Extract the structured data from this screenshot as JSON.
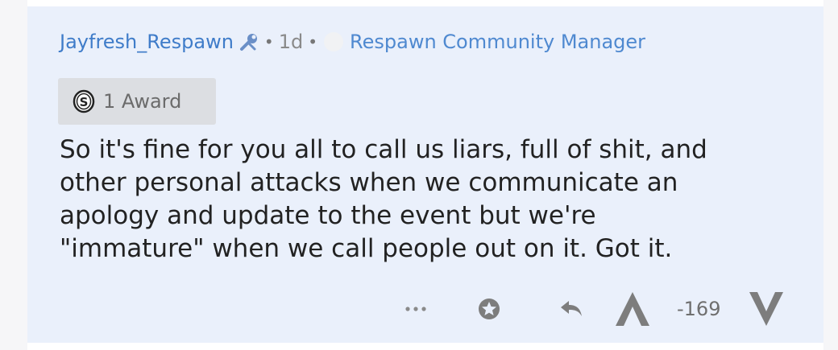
{
  "comment": {
    "username": "Jayfresh_Respawn",
    "age": "1d",
    "separator": "•",
    "flair": "Respawn Community Manager",
    "award_label": "1 Award",
    "body_lines": [
      "So it's fine for you all to call us liars, full of shit, and",
      "other personal attacks when we communicate an",
      "apology and update to the event but we're",
      "\"immature\" when we call people out on it. Got it."
    ],
    "score": "-169"
  },
  "icons": {
    "moderator": "wrench-icon",
    "award": "silver-award-icon",
    "more": "more-options-icon",
    "save": "star-outline-icon",
    "reply": "reply-arrow-icon",
    "upvote": "upvote-arrow-icon",
    "downvote": "downvote-arrow-icon"
  },
  "colors": {
    "username": "#3f7cc9",
    "flair": "#4f89d0",
    "card_background": "#eaf0fb",
    "icon_gray": "#7d7d7d"
  }
}
